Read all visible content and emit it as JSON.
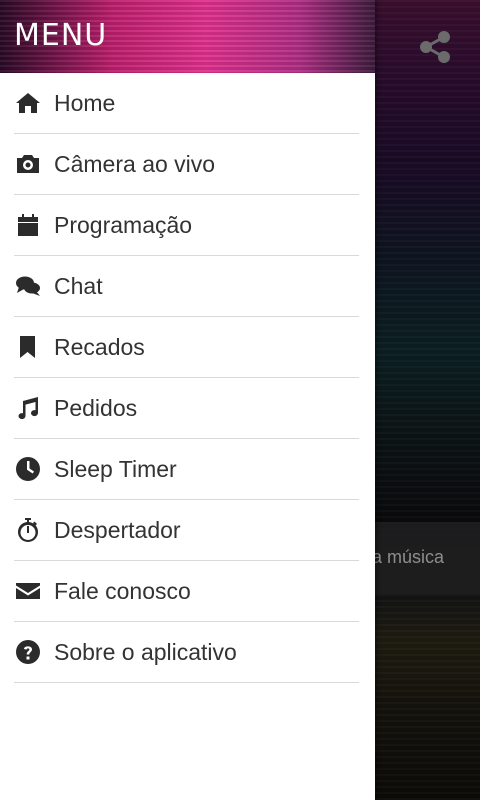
{
  "drawer": {
    "title": "MENU",
    "items": [
      {
        "label": "Home",
        "icon": "home-icon"
      },
      {
        "label": "Câmera ao vivo",
        "icon": "camera-icon"
      },
      {
        "label": "Programação",
        "icon": "calendar-icon"
      },
      {
        "label": "Chat",
        "icon": "chat-icon"
      },
      {
        "label": "Recados",
        "icon": "bookmark-icon"
      },
      {
        "label": "Pedidos",
        "icon": "music-note-icon"
      },
      {
        "label": "Sleep Timer",
        "icon": "clock-icon"
      },
      {
        "label": "Despertador",
        "icon": "stopwatch-icon"
      },
      {
        "label": "Fale conosco",
        "icon": "envelope-icon"
      },
      {
        "label": "Sobre o aplicativo",
        "icon": "question-circle-icon"
      }
    ]
  },
  "background": {
    "share_icon": "share-icon",
    "song_text": "a música"
  },
  "colors": {
    "header_accent": "#e2328e",
    "text": "#333333",
    "divider": "#d9d9d9"
  }
}
